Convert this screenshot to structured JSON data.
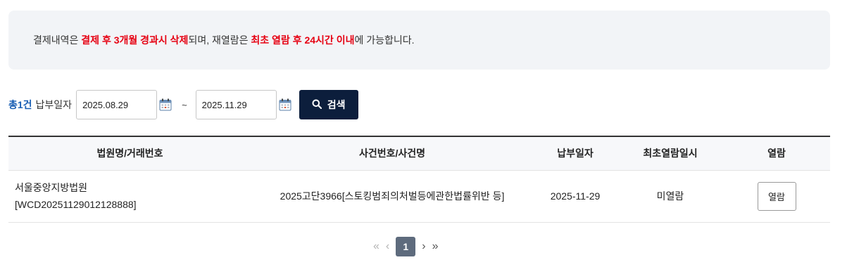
{
  "notice": {
    "p1": "결제내역은 ",
    "r1": "결제 후 3개월 경과시 삭제",
    "p2": "되며, 재열람은 ",
    "r2": "최초 열람 후 24시간 이내",
    "p3": "에 가능합니다."
  },
  "search": {
    "total": "총1건",
    "date_label": "납부일자",
    "start_date": "2025.08.29",
    "tilde": "~",
    "end_date": "2025.11.29",
    "button_label": "검색"
  },
  "table": {
    "headers": [
      "법원명/거래번호",
      "사건번호/사건명",
      "납부일자",
      "최초열람일시",
      "열람"
    ],
    "rows": [
      {
        "court": "서울중앙지방법원",
        "txn": "[WCD20251129012128888]",
        "case": "2025고단3966[스토킹범죄의처벌등에관한법률위반 등]",
        "pay_date": "2025-11-29",
        "first_view": "미열람",
        "view_label": "열람"
      }
    ]
  },
  "pager": {
    "first": "«",
    "prev": "‹",
    "current": "1",
    "next": "›",
    "last": "»"
  },
  "colors": {
    "accent_red": "#e60012",
    "total_blue": "#1a5fb4",
    "button_navy": "#0c1e3c",
    "page_active": "#5e6b7d"
  },
  "icons": {
    "calendar": "calendar-icon",
    "search": "search-icon"
  }
}
